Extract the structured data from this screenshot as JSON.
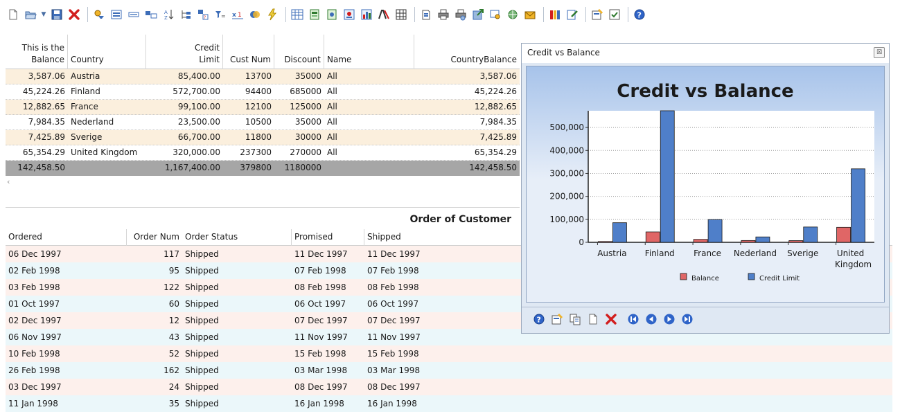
{
  "toolbar": {
    "buttons": [
      {
        "icon": "new-page-icon"
      },
      {
        "icon": "open-folder-icon"
      },
      {
        "icon": "save-icon"
      },
      {
        "icon": "delete-icon"
      },
      {
        "icon": "filter-icon"
      },
      {
        "icon": "form-view-icon"
      },
      {
        "icon": "field-icon"
      },
      {
        "icon": "field-group-icon"
      },
      {
        "icon": "sort-az-icon"
      },
      {
        "icon": "tree-icon"
      },
      {
        "icon": "lookup-icon"
      },
      {
        "icon": "where-icon"
      },
      {
        "icon": "formula-icon"
      },
      {
        "icon": "join-icon"
      },
      {
        "icon": "lightning-icon"
      },
      {
        "icon": "grid-report-icon"
      },
      {
        "icon": "report-icon"
      },
      {
        "icon": "report-wizard-icon"
      },
      {
        "icon": "label-report-icon"
      },
      {
        "icon": "chart-report-icon"
      },
      {
        "icon": "crosstab-icon"
      },
      {
        "icon": "matrix-icon"
      },
      {
        "icon": "print-setup-icon"
      },
      {
        "icon": "print-icon"
      },
      {
        "icon": "print-preview-icon"
      },
      {
        "icon": "export-icon"
      },
      {
        "icon": "preview-icon"
      },
      {
        "icon": "web-icon"
      },
      {
        "icon": "mail-icon"
      },
      {
        "icon": "books-icon"
      },
      {
        "icon": "edit-book-icon"
      },
      {
        "icon": "properties-icon"
      },
      {
        "icon": "checklist-icon"
      },
      {
        "icon": "help-icon"
      }
    ]
  },
  "customers": {
    "columns": [
      "This is the\nBalance",
      "Country",
      "Credit\nLimit",
      "Cust Num",
      "Discount",
      "Name",
      "CountryBalance"
    ],
    "rows": [
      {
        "balance": "3,587.06",
        "country": "Austria",
        "credit": "85,400.00",
        "cust": "13700",
        "discount": "35000",
        "name": "All",
        "cbal": "3,587.06"
      },
      {
        "balance": "45,224.26",
        "country": "Finland",
        "credit": "572,700.00",
        "cust": "94400",
        "discount": "685000",
        "name": "All",
        "cbal": "45,224.26"
      },
      {
        "balance": "12,882.65",
        "country": "France",
        "credit": "99,100.00",
        "cust": "12100",
        "discount": "125000",
        "name": "All",
        "cbal": "12,882.65"
      },
      {
        "balance": "7,984.35",
        "country": "Nederland",
        "credit": "23,500.00",
        "cust": "10500",
        "discount": "35000",
        "name": "All",
        "cbal": "7,984.35"
      },
      {
        "balance": "7,425.89",
        "country": "Sverige",
        "credit": "66,700.00",
        "cust": "11800",
        "discount": "30000",
        "name": "All",
        "cbal": "7,425.89"
      },
      {
        "balance": "65,354.29",
        "country": "United Kingdom",
        "credit": "320,000.00",
        "cust": "237300",
        "discount": "270000",
        "name": "All",
        "cbal": "65,354.29"
      }
    ],
    "total": {
      "balance": "142,458.50",
      "credit": "1,167,400.00",
      "cust": "379800",
      "discount": "1180000",
      "cbal": "142,458.50"
    },
    "scroll_left": "‹"
  },
  "orders": {
    "caption": "Order of Customer",
    "columns": [
      "Ordered",
      "Order Num",
      "Order Status",
      "Promised",
      "Shipped"
    ],
    "rows": [
      {
        "ordered": "06 Dec 1997",
        "num": "117",
        "status": "Shipped",
        "promised": "11 Dec 1997",
        "shipped": "11 Dec 1997"
      },
      {
        "ordered": "02 Feb 1998",
        "num": "95",
        "status": "Shipped",
        "promised": "07 Feb 1998",
        "shipped": "07 Feb 1998"
      },
      {
        "ordered": "03 Feb 1998",
        "num": "122",
        "status": "Shipped",
        "promised": "08 Feb 1998",
        "shipped": "08 Feb 1998"
      },
      {
        "ordered": "01 Oct 1997",
        "num": "60",
        "status": "Shipped",
        "promised": "06 Oct 1997",
        "shipped": "06 Oct 1997"
      },
      {
        "ordered": "02 Dec 1997",
        "num": "12",
        "status": "Shipped",
        "promised": "07 Dec 1997",
        "shipped": "07 Dec 1997"
      },
      {
        "ordered": "06 Nov 1997",
        "num": "43",
        "status": "Shipped",
        "promised": "11 Nov 1997",
        "shipped": "11 Nov 1997"
      },
      {
        "ordered": "10 Feb 1998",
        "num": "52",
        "status": "Shipped",
        "promised": "15 Feb 1998",
        "shipped": "15 Feb 1998"
      },
      {
        "ordered": "26 Feb 1998",
        "num": "162",
        "status": "Shipped",
        "promised": "03 Mar 1998",
        "shipped": "03 Mar 1998"
      },
      {
        "ordered": "03 Dec 1997",
        "num": "24",
        "status": "Shipped",
        "promised": "08 Dec 1997",
        "shipped": "08 Dec 1997"
      },
      {
        "ordered": "11 Jan 1998",
        "num": "35",
        "status": "Shipped",
        "promised": "16 Jan 1998",
        "shipped": "16 Jan 1998"
      }
    ]
  },
  "chart_window": {
    "title": "Credit vs Balance",
    "close_label": "☒",
    "nav_buttons": [
      "help-icon",
      "properties-icon",
      "copy-icon",
      "new-page-icon",
      "delete-icon",
      "first-record-icon",
      "previous-record-icon",
      "next-record-icon",
      "last-record-icon"
    ]
  },
  "chart_data": {
    "type": "bar",
    "title": "Credit vs Balance",
    "categories": [
      "Austria",
      "Finland",
      "France",
      "Nederland",
      "Sverige",
      "United Kingdom"
    ],
    "category_lines": [
      [
        "Austria"
      ],
      [
        "Finland"
      ],
      [
        "France"
      ],
      [
        "Nederland"
      ],
      [
        "Sverige"
      ],
      [
        "United",
        "Kingdom"
      ]
    ],
    "series": [
      {
        "name": "Balance",
        "color": "#e06666",
        "values": [
          3587.06,
          45224.26,
          12882.65,
          7984.35,
          7425.89,
          65354.29
        ]
      },
      {
        "name": "Credit Limit",
        "color": "#4f7fc9",
        "values": [
          85400,
          572700,
          99100,
          23500,
          66700,
          320000
        ]
      }
    ],
    "ylim": [
      0,
      572700
    ],
    "yticks": [
      0,
      100000,
      200000,
      300000,
      400000,
      500000
    ],
    "ytick_labels": [
      "0",
      "100,000",
      "200,000",
      "300,000",
      "400,000",
      "500,000"
    ],
    "grid": true,
    "legend": "bottom"
  },
  "colors": {
    "row_alt": "#fbefdd",
    "total_row": "#a6a6a6",
    "order_pink": "#fdf0ec",
    "order_blue": "#ebf7fa"
  }
}
